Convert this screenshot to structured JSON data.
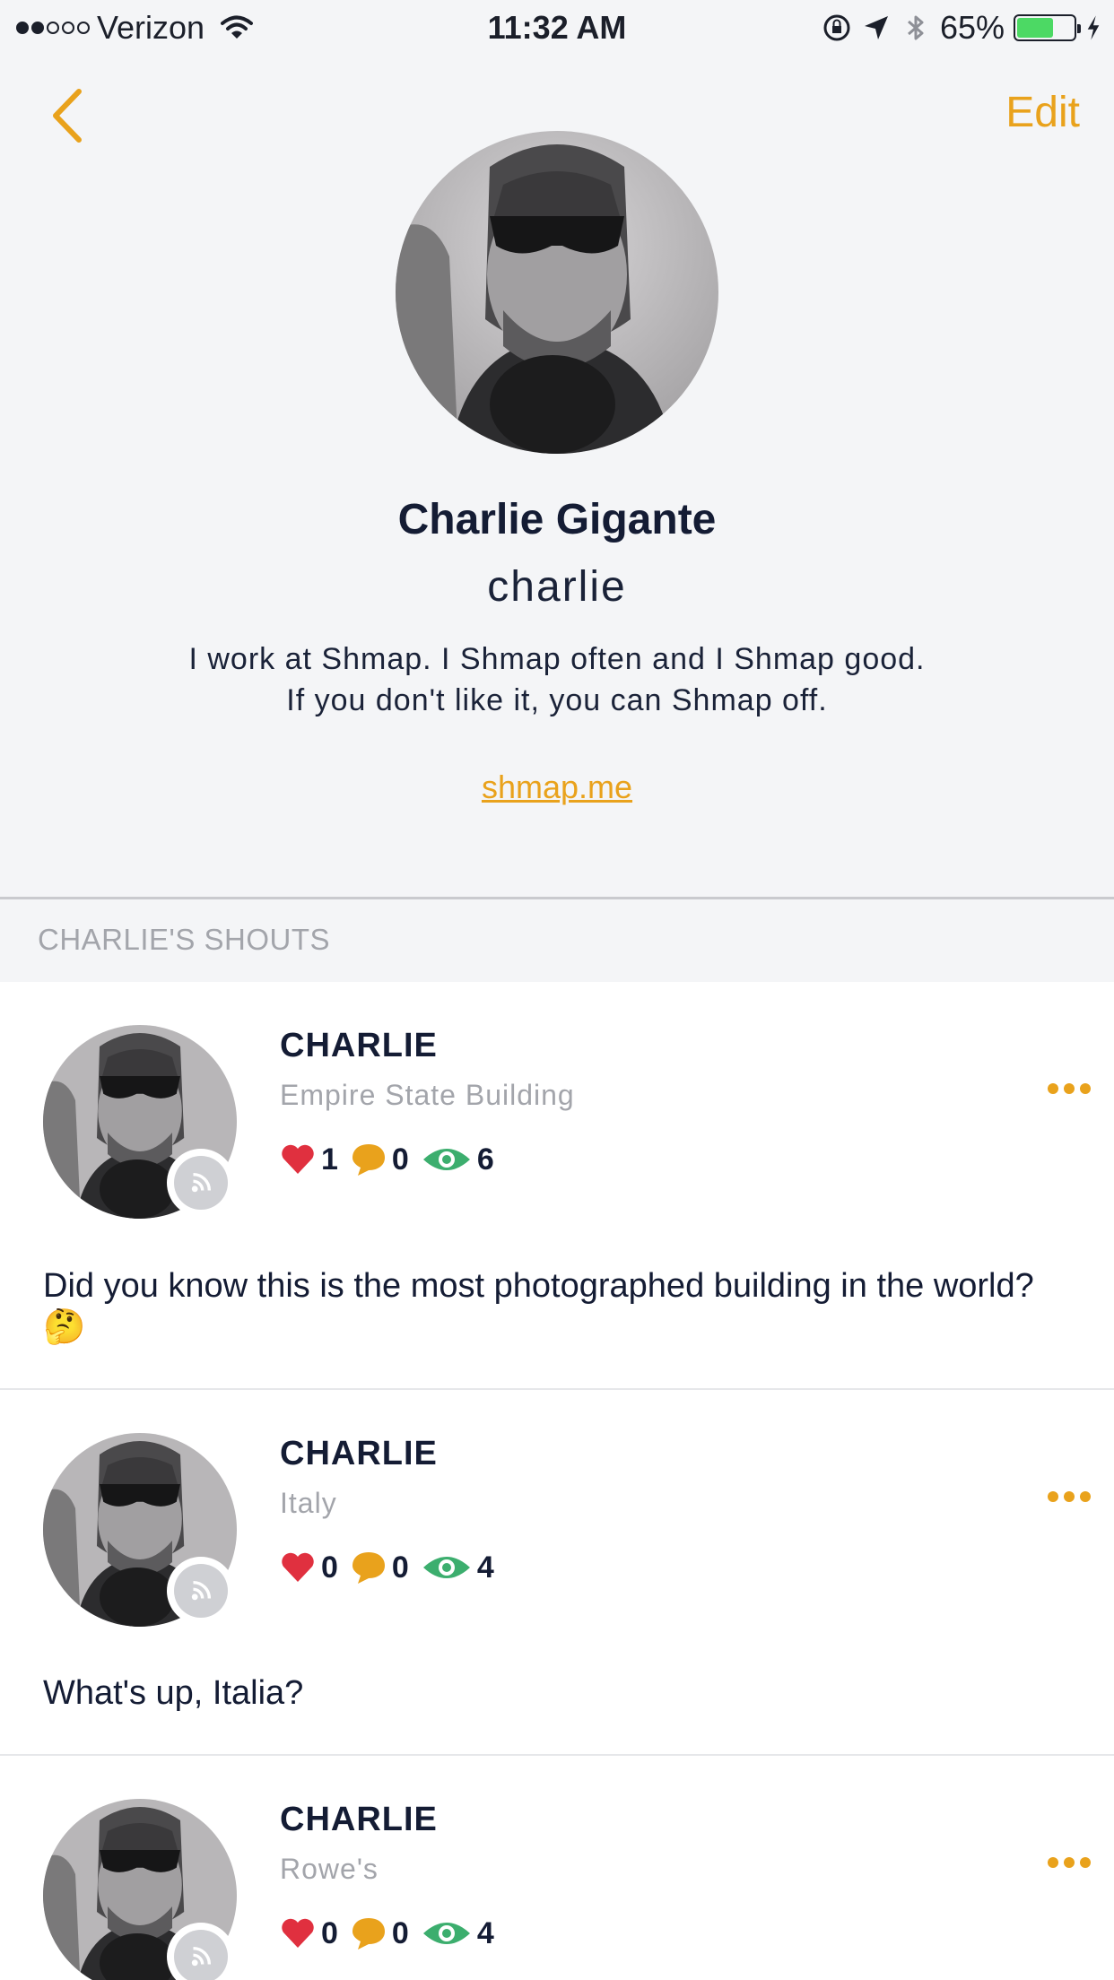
{
  "status_bar": {
    "carrier": "Verizon",
    "time": "11:32 AM",
    "battery_percent": "65%",
    "battery_level": 0.65
  },
  "nav": {
    "edit_label": "Edit"
  },
  "profile": {
    "name": "Charlie Gigante",
    "username": "charlie",
    "bio": "I work at Shmap. I Shmap often and I Shmap good. If you don't like it, you can Shmap off.",
    "website": "shmap.me"
  },
  "section": {
    "title": "CHARLIE'S SHOUTS"
  },
  "shouts": [
    {
      "author": "CHARLIE",
      "location": "Empire State Building",
      "likes": "1",
      "comments": "0",
      "views": "6",
      "text": "Did you know this is the most photographed building in the world? 🤔"
    },
    {
      "author": "CHARLIE",
      "location": "Italy",
      "likes": "0",
      "comments": "0",
      "views": "4",
      "text": "What's up, Italia?"
    },
    {
      "author": "CHARLIE",
      "location": "Rowe's",
      "likes": "0",
      "comments": "0",
      "views": "4",
      "text": ""
    }
  ],
  "colors": {
    "accent": "#e9a21c",
    "heart": "#e0303f",
    "eye": "#3cae6e",
    "battery": "#4cd964"
  },
  "icons": {
    "back": "chevron-left-icon",
    "like": "heart-icon",
    "comment": "speech-bubble-icon",
    "views": "eye-icon",
    "more": "ellipsis-icon",
    "badge": "broadcast-icon"
  }
}
